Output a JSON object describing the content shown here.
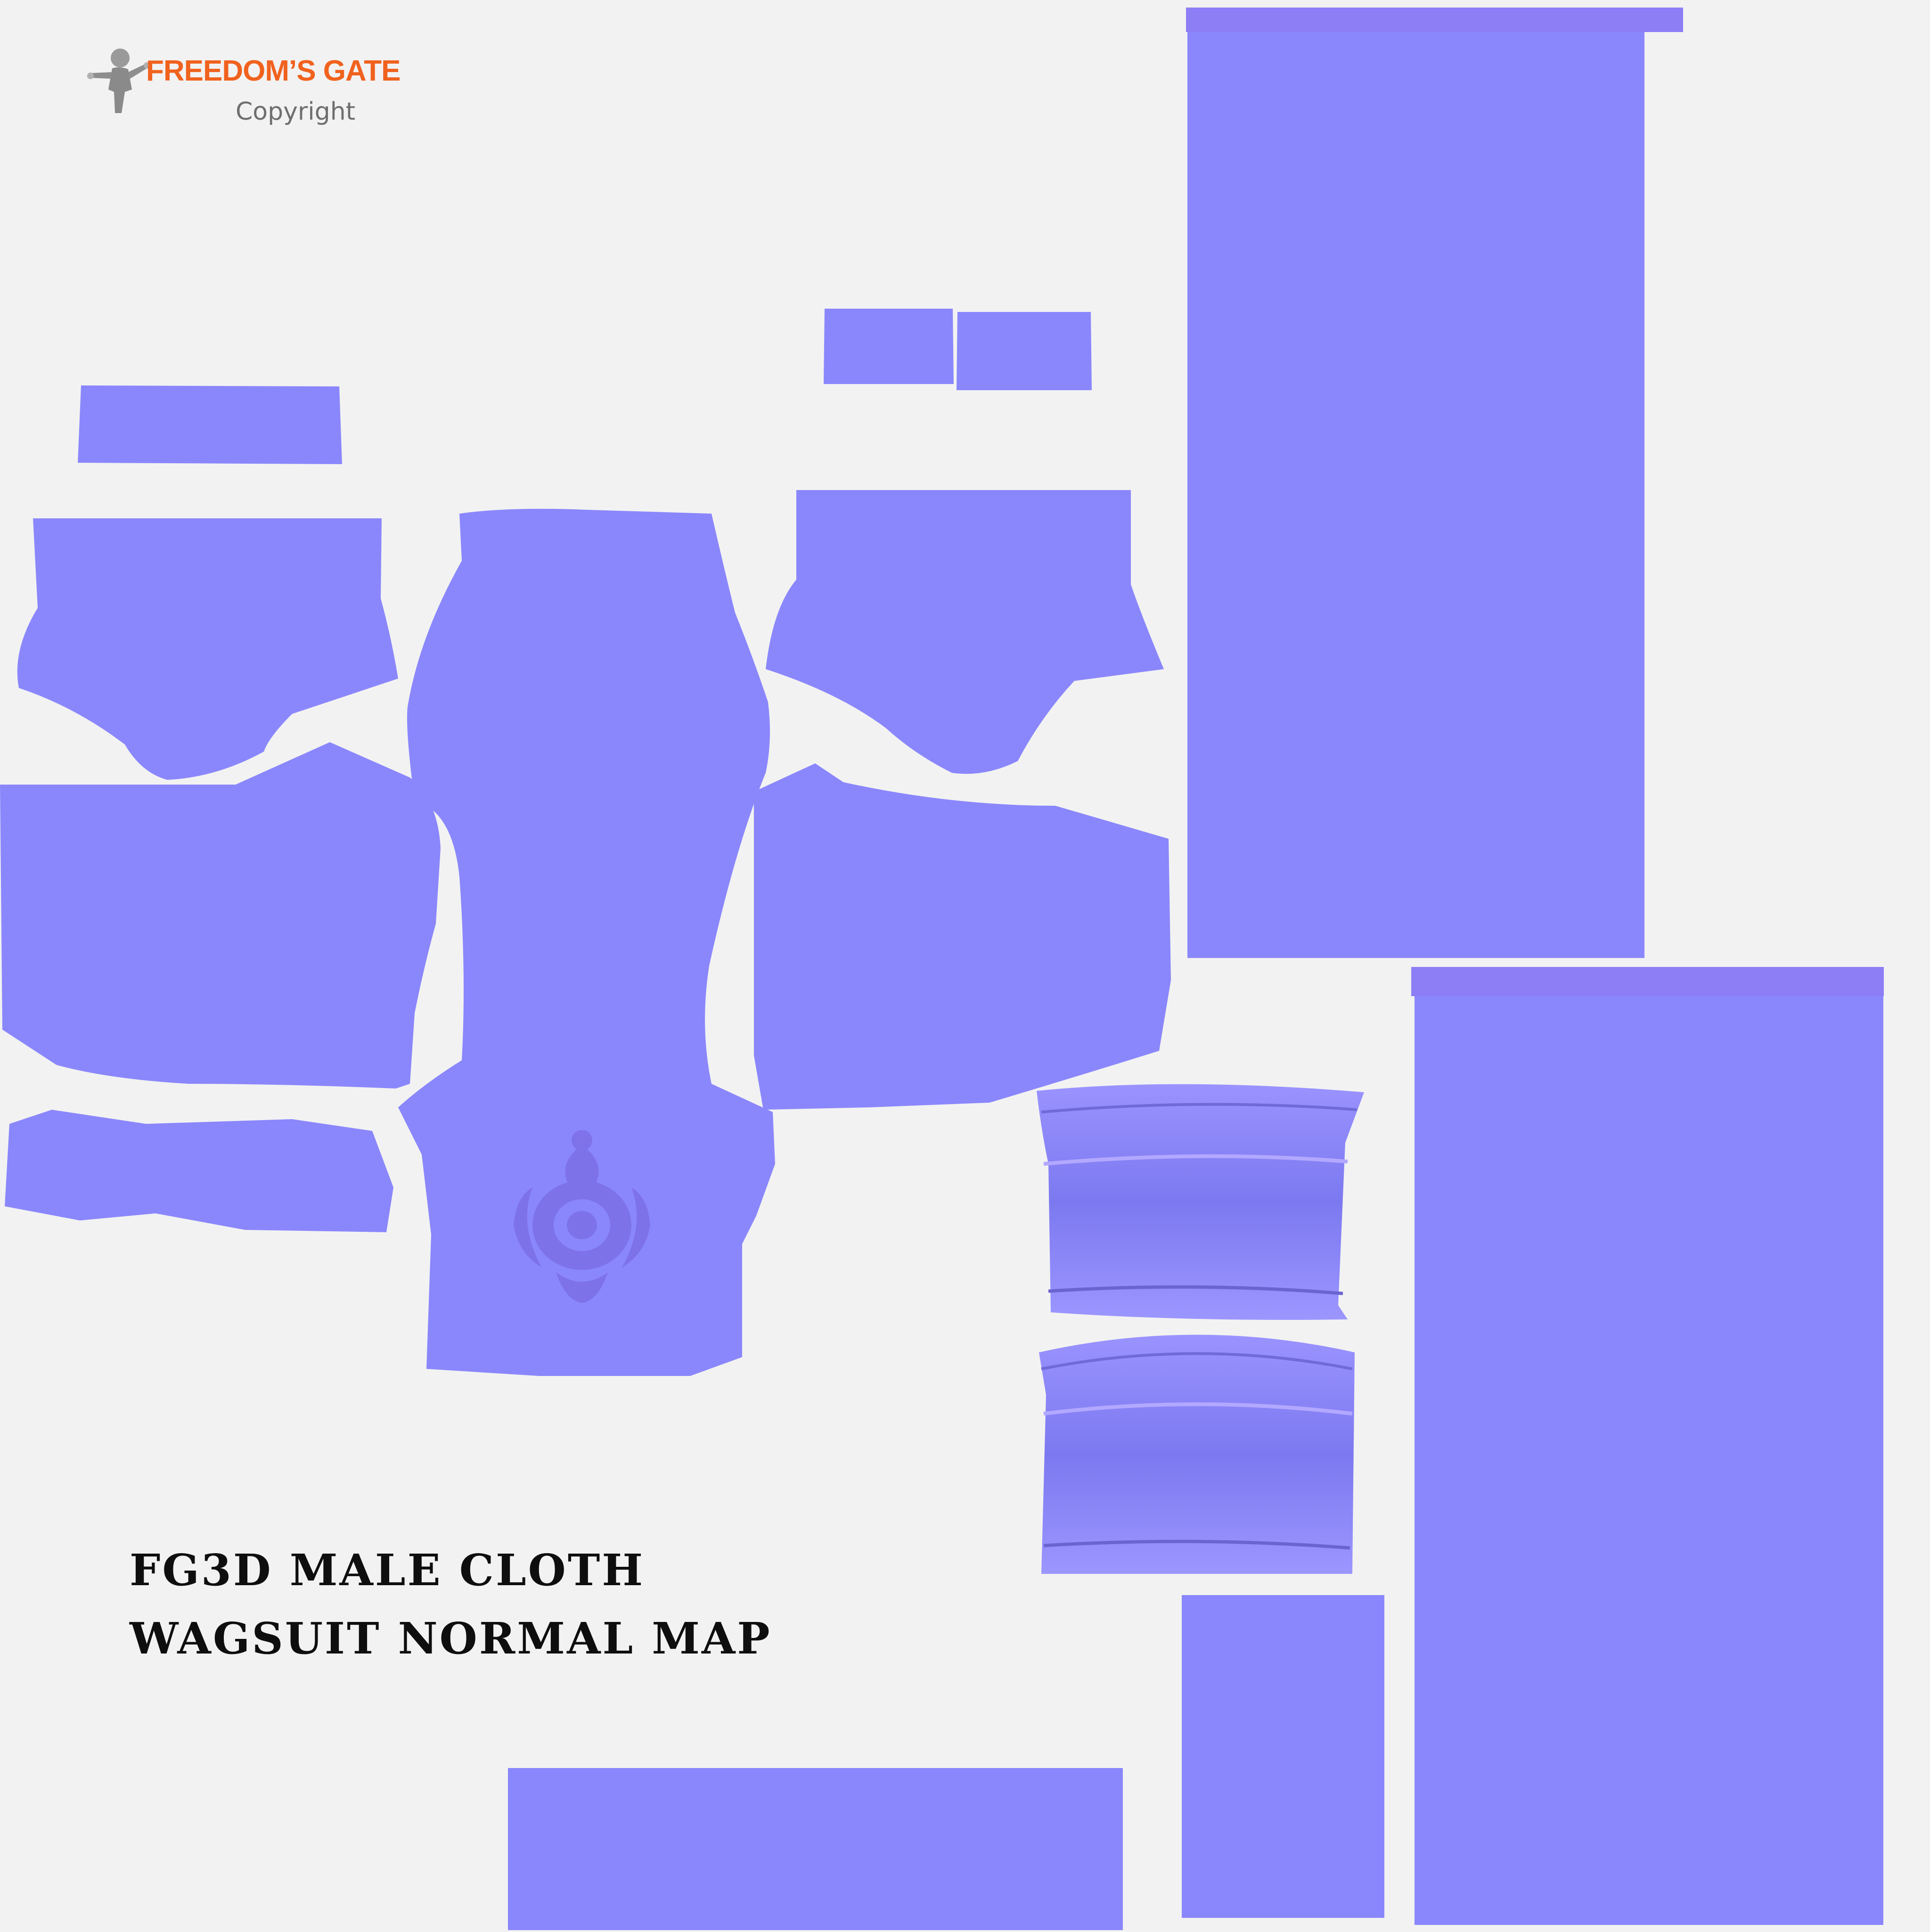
{
  "logo": {
    "brand": "FREEDOM’S GATE",
    "notice": "Copyright",
    "icon": "figure-icon"
  },
  "caption": {
    "line1": "FG3D MALE CLOTH",
    "line2": "WAGSUIT NORMAL MAP"
  },
  "colors": {
    "background": "#f2f2f2",
    "uv_fill": "#8a87fc",
    "uv_edge": "#8d7ef6",
    "detail_shade": "#7a72e8",
    "ornament": "#7d6fe6",
    "brand": "#f0621e",
    "notice": "#6e6e6e",
    "caption": "#0e0e0e"
  }
}
